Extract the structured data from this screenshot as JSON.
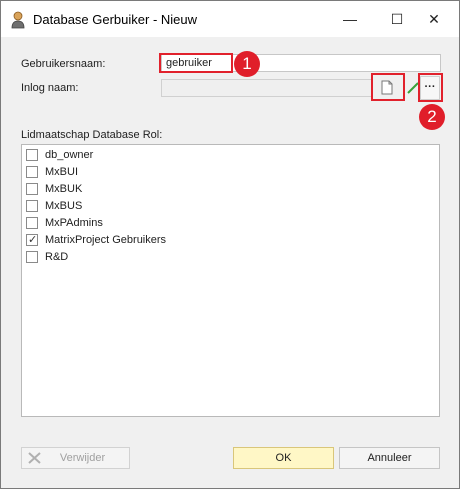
{
  "window": {
    "title": "Database Gerbuiker - Nieuw",
    "icons": {
      "app": "user-icon",
      "minimize": "minimize-icon",
      "maximize": "maximize-icon",
      "close": "close-icon"
    },
    "controls": {
      "minimize": "—",
      "maximize": "☐",
      "close": "✕"
    }
  },
  "form": {
    "username_label": "Gebruikersnaam:",
    "username_value": "gebruiker",
    "login_label": "Inlog naam:",
    "login_value": "",
    "new_login_icon": "document-icon",
    "edit_icon": "pencil-icon",
    "browse_label": "···"
  },
  "annotations": {
    "badge1": "1",
    "badge2": "2",
    "color": "#e1212c"
  },
  "roles": {
    "heading": "Lidmaatschap Database Rol:",
    "items": [
      {
        "label": "db_owner",
        "checked": false
      },
      {
        "label": "MxBUI",
        "checked": false
      },
      {
        "label": "MxBUK",
        "checked": false
      },
      {
        "label": "MxBUS",
        "checked": false
      },
      {
        "label": "MxPAdmins",
        "checked": false
      },
      {
        "label": "MatrixProject Gebruikers",
        "checked": true
      },
      {
        "label": "R&D",
        "checked": false
      }
    ]
  },
  "buttons": {
    "delete_label": "Verwijder",
    "delete_icon": "x-icon",
    "ok_label": "OK",
    "cancel_label": "Annuleer"
  }
}
